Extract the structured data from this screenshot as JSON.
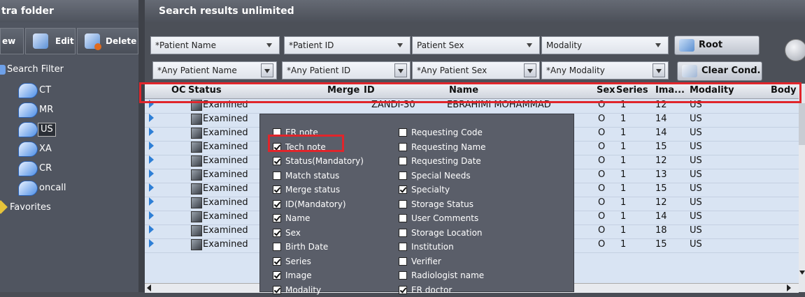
{
  "left_panel": {
    "title": "tra folder",
    "toolbar": {
      "view_label": "ew",
      "edit_label": "Edit",
      "delete_label": "Delete"
    },
    "search_filter_label": "Search Filter",
    "items": [
      "CT",
      "MR",
      "US",
      "XA",
      "CR",
      "oncall"
    ],
    "selected_item": "US",
    "favorites_label": "Favorites"
  },
  "right_panel": {
    "title": "Search results  unlimited",
    "filters_row1": [
      "*Patient Name",
      "*Patient ID",
      "Patient Sex",
      "Modality"
    ],
    "filters_row2": [
      "*Any Patient Name",
      "*Any Patient ID",
      "*Any Patient Sex",
      "*Any Modality"
    ],
    "root_button": "Root",
    "clear_button": "Clear Cond."
  },
  "grid": {
    "columns": [
      "OC",
      "Status",
      "Merge",
      "ID",
      "Name",
      "Sex",
      "Series",
      "Ima...",
      "Modality",
      "Body"
    ],
    "rows": [
      {
        "status": "Examined",
        "id": "ZANDI-30",
        "name": "EBRAHIMI MOHAMMAD",
        "sex": "O",
        "series": "1",
        "images": "12",
        "modality": "US"
      },
      {
        "status": "Examined",
        "id": "",
        "name": "",
        "sex": "O",
        "series": "1",
        "images": "14",
        "modality": "US"
      },
      {
        "status": "Examined",
        "id": "",
        "name": "",
        "sex": "O",
        "series": "1",
        "images": "14",
        "modality": "US"
      },
      {
        "status": "Examined",
        "id": "",
        "name": "",
        "sex": "O",
        "series": "1",
        "images": "15",
        "modality": "US"
      },
      {
        "status": "Examined",
        "id": "",
        "name": "",
        "sex": "O",
        "series": "1",
        "images": "12",
        "modality": "US"
      },
      {
        "status": "Examined",
        "id": "",
        "name": "",
        "sex": "O",
        "series": "1",
        "images": "13",
        "modality": "US"
      },
      {
        "status": "Examined",
        "id": "",
        "name": "",
        "sex": "O",
        "series": "1",
        "images": "15",
        "modality": "US"
      },
      {
        "status": "Examined",
        "id": "",
        "name": "",
        "sex": "O",
        "series": "1",
        "images": "12",
        "modality": "US"
      },
      {
        "status": "Examined",
        "id": "",
        "name": "",
        "sex": "O",
        "series": "1",
        "images": "14",
        "modality": "US"
      },
      {
        "status": "Examined",
        "id": "",
        "name": "",
        "sex": "O",
        "series": "1",
        "images": "18",
        "modality": "US"
      },
      {
        "status": "Examined",
        "id": "",
        "name": "",
        "sex": "O",
        "series": "1",
        "images": "15",
        "modality": "US"
      }
    ]
  },
  "column_menu": {
    "left": [
      {
        "label": "ER note",
        "checked": false
      },
      {
        "label": "Tech note",
        "checked": true
      },
      {
        "label": "Status(Mandatory)",
        "checked": true
      },
      {
        "label": "Match status",
        "checked": false
      },
      {
        "label": "Merge status",
        "checked": true
      },
      {
        "label": "ID(Mandatory)",
        "checked": true
      },
      {
        "label": "Name",
        "checked": true
      },
      {
        "label": "Sex",
        "checked": true
      },
      {
        "label": "Birth Date",
        "checked": false
      },
      {
        "label": "Series",
        "checked": true
      },
      {
        "label": "Image",
        "checked": true
      },
      {
        "label": "Modality",
        "checked": true
      }
    ],
    "right": [
      {
        "label": "Requesting Code",
        "checked": false
      },
      {
        "label": "Requesting Name",
        "checked": false
      },
      {
        "label": "Requesting Date",
        "checked": false
      },
      {
        "label": "Special Needs",
        "checked": false
      },
      {
        "label": "Specialty",
        "checked": true
      },
      {
        "label": "Storage Status",
        "checked": false
      },
      {
        "label": "User Comments",
        "checked": false
      },
      {
        "label": "Storage Location",
        "checked": false
      },
      {
        "label": "Institution",
        "checked": false
      },
      {
        "label": "Verifier",
        "checked": false
      },
      {
        "label": "Radiologist name",
        "checked": false
      },
      {
        "label": "ER doctor",
        "checked": true
      }
    ]
  },
  "colors": {
    "highlight": "#e0252b",
    "accent": "#2e7fd6"
  }
}
